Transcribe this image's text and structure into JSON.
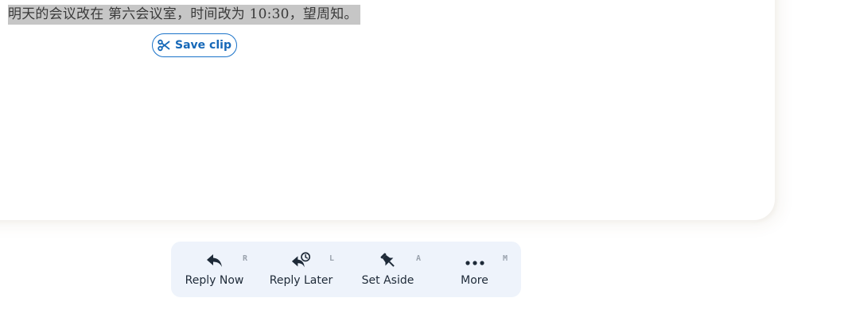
{
  "email": {
    "selected_text": "明天的会议改在 第六会议室，时间改为 10:30，望周知。"
  },
  "save_clip": {
    "label": "Save clip",
    "icon": "scissors-icon"
  },
  "toolbar": {
    "actions": [
      {
        "label": "Reply Now",
        "shortcut": "R",
        "icon": "reply-icon"
      },
      {
        "label": "Reply Later",
        "shortcut": "L",
        "icon": "reply-later-clock-icon"
      },
      {
        "label": "Set Aside",
        "shortcut": "A",
        "icon": "pin-icon"
      },
      {
        "label": "More",
        "shortcut": "M",
        "icon": "more-dots-icon"
      }
    ]
  },
  "colors": {
    "accent": "#1a73c9",
    "toolbar_bg": "#eef3fb",
    "selection_bg": "#c6c6c6",
    "icon": "#1e2a38"
  }
}
